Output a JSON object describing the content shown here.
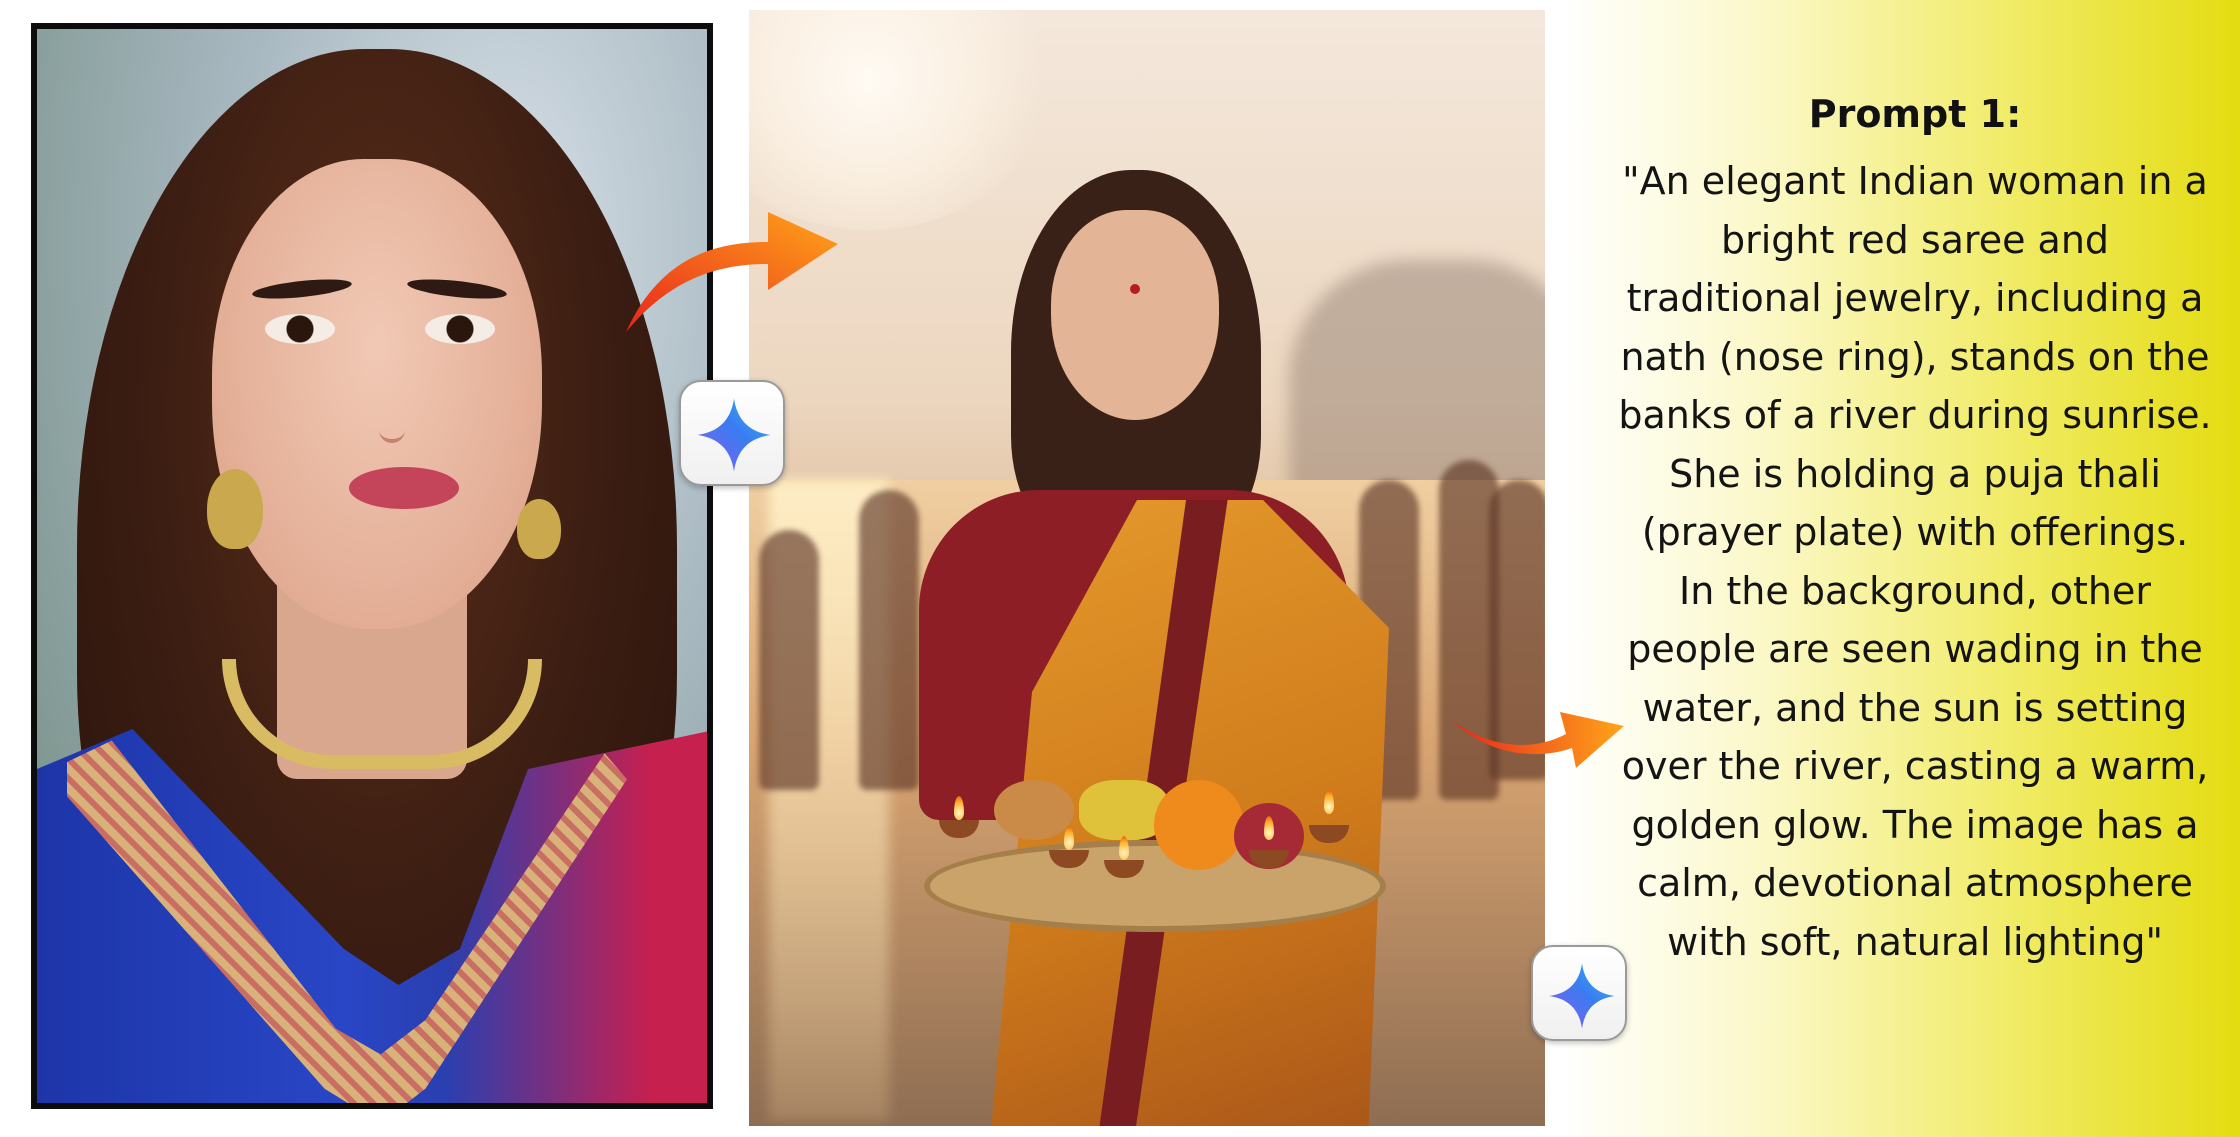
{
  "prompt": {
    "title": "Prompt 1:",
    "text": "\"An elegant Indian woman in a\nbright red saree and\ntraditional jewelry, including a\nnath (nose ring), stands on the\nbanks of a river during sunrise.\nShe is holding a puja thali\n(prayer plate) with offerings.\nIn the background, other\npeople are seen wading in the\nwater, and the sun is setting\nover the river, casting a warm,\ngolden glow. The image has a\ncalm, devotional atmosphere\nwith soft, natural lighting\""
  },
  "icons": {
    "badge": "gemini-sparkle-icon",
    "arrow": "curved-arrow-icon"
  },
  "colors": {
    "gradient_end": "#e4dc10",
    "arrow_start": "#e8251c",
    "arrow_end": "#ffa51a",
    "sparkle_blue": "#3a7cf0",
    "sparkle_purple": "#8a5cf0"
  }
}
